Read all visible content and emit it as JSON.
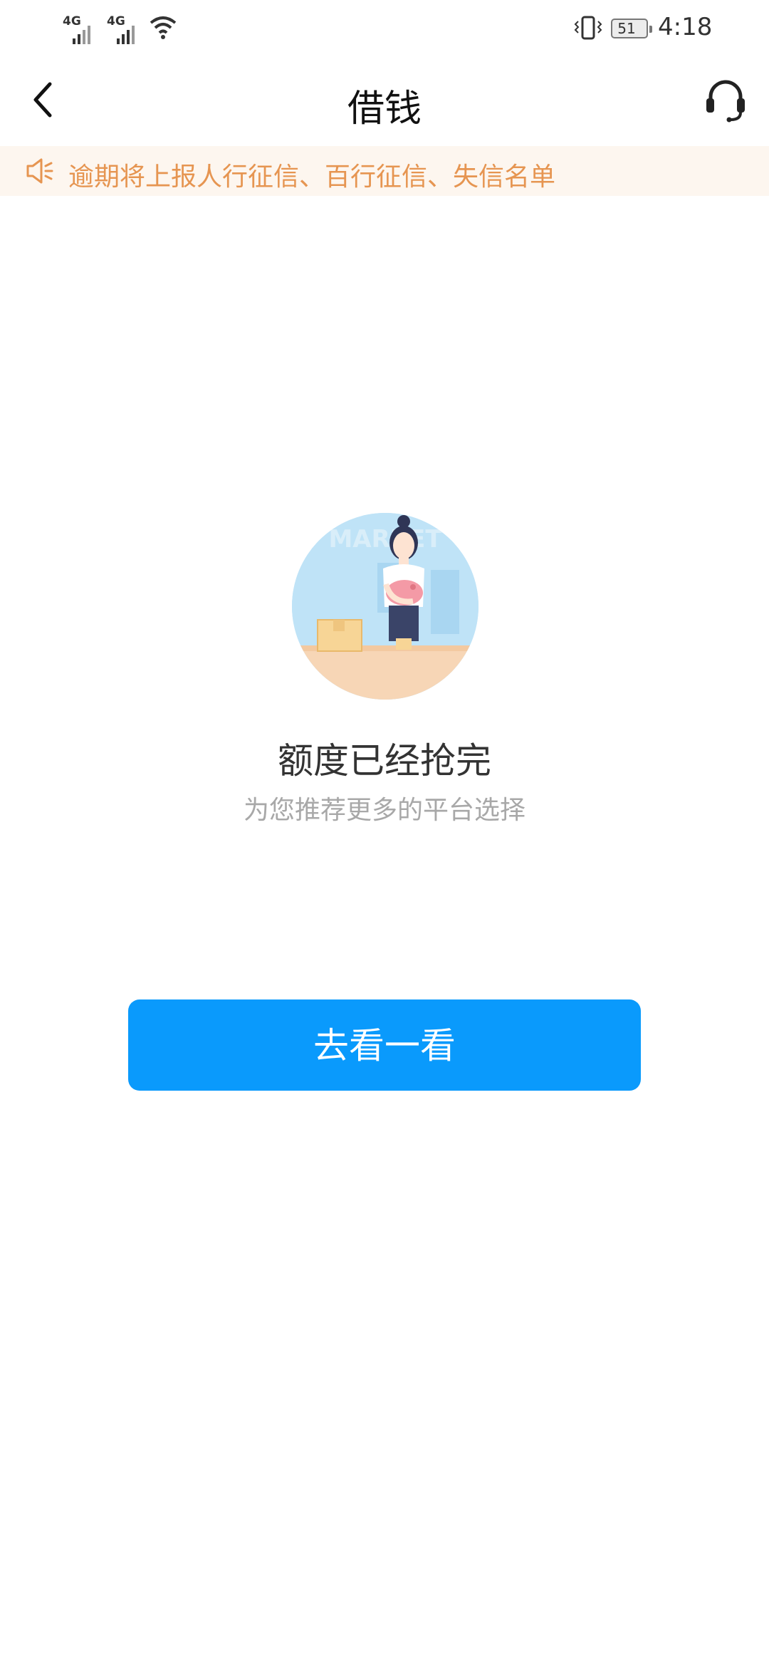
{
  "status_bar": {
    "network_1": "4G",
    "network_2": "4G",
    "battery_level": "51",
    "time": "4:18"
  },
  "header": {
    "title": "借钱",
    "back_icon": "chevron-left-icon",
    "service_icon": "headset-icon"
  },
  "notice": {
    "icon": "speaker-icon",
    "text": "逾期将上报人行征信、百行征信、失信名单",
    "color": "#e69551",
    "background": "#fdf6ef"
  },
  "empty_state": {
    "title": "额度已经抢完",
    "subtitle": "为您推荐更多的平台选择",
    "illustration_text": "MARKET"
  },
  "cta": {
    "label": "去看一看",
    "color": "#0a9afc"
  }
}
